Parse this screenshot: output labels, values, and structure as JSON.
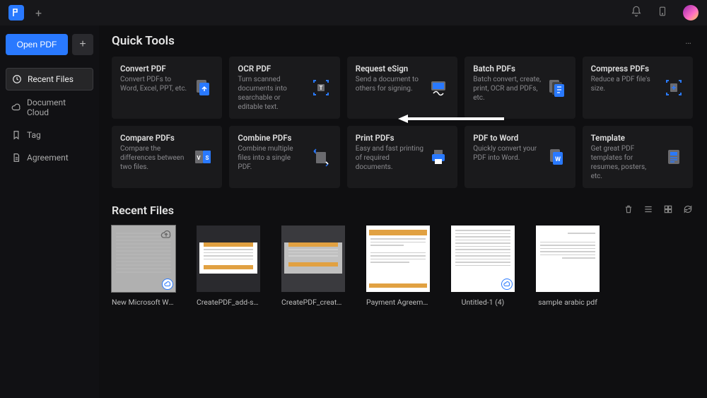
{
  "titlebar": {
    "add_tab": "+"
  },
  "sidebar": {
    "open_pdf": "Open PDF",
    "new": "+",
    "items": [
      {
        "label": "Recent Files",
        "icon": "clock-icon",
        "active": true
      },
      {
        "label": "Document Cloud",
        "icon": "cloud-icon",
        "active": false
      },
      {
        "label": "Tag",
        "icon": "bookmark-icon",
        "active": false
      },
      {
        "label": "Agreement",
        "icon": "document-icon",
        "active": false
      }
    ]
  },
  "quick_tools": {
    "title": "Quick Tools",
    "more": "…",
    "tools": [
      {
        "title": "Convert PDF",
        "desc": "Convert PDFs to Word, Excel, PPT, etc.",
        "icon": "convert-icon"
      },
      {
        "title": "OCR PDF",
        "desc": "Turn scanned documents into searchable or editable text.",
        "icon": "ocr-icon"
      },
      {
        "title": "Request eSign",
        "desc": "Send a document to others for signing.",
        "icon": "esign-icon"
      },
      {
        "title": "Batch PDFs",
        "desc": "Batch convert, create, print, OCR and PDFs, etc.",
        "icon": "batch-icon"
      },
      {
        "title": "Compress PDFs",
        "desc": "Reduce a PDF file's size.",
        "icon": "compress-icon"
      },
      {
        "title": "Compare PDFs",
        "desc": "Compare the differences between two files.",
        "icon": "compare-icon"
      },
      {
        "title": "Combine PDFs",
        "desc": "Combine multiple files into a single PDF.",
        "icon": "combine-icon"
      },
      {
        "title": "Print PDFs",
        "desc": "Easy and fast printing of required documents.",
        "icon": "print-icon"
      },
      {
        "title": "PDF to Word",
        "desc": "Quickly convert your PDF into Word.",
        "icon": "word-icon"
      },
      {
        "title": "Template",
        "desc": "Get great PDF templates for resumes, posters, etc.",
        "icon": "template-icon"
      }
    ]
  },
  "recent_files": {
    "title": "Recent Files",
    "files": [
      {
        "name": "New Microsoft Wo…",
        "thumb": "gray-lines",
        "cloud": true,
        "upload": true,
        "selected": true
      },
      {
        "name": "CreatePDF_add-si…",
        "thumb": "doc-band",
        "cloud": false
      },
      {
        "name": "CreatePDF_create…",
        "thumb": "dark-band",
        "cloud": false
      },
      {
        "name": "Payment Agreement",
        "thumb": "form",
        "cloud": false
      },
      {
        "name": "Untitled-1 (4)",
        "thumb": "text",
        "cloud": true
      },
      {
        "name": "sample arabic pdf",
        "thumb": "text-rtl",
        "cloud": false
      }
    ]
  },
  "colors": {
    "accent": "#2979ff"
  }
}
